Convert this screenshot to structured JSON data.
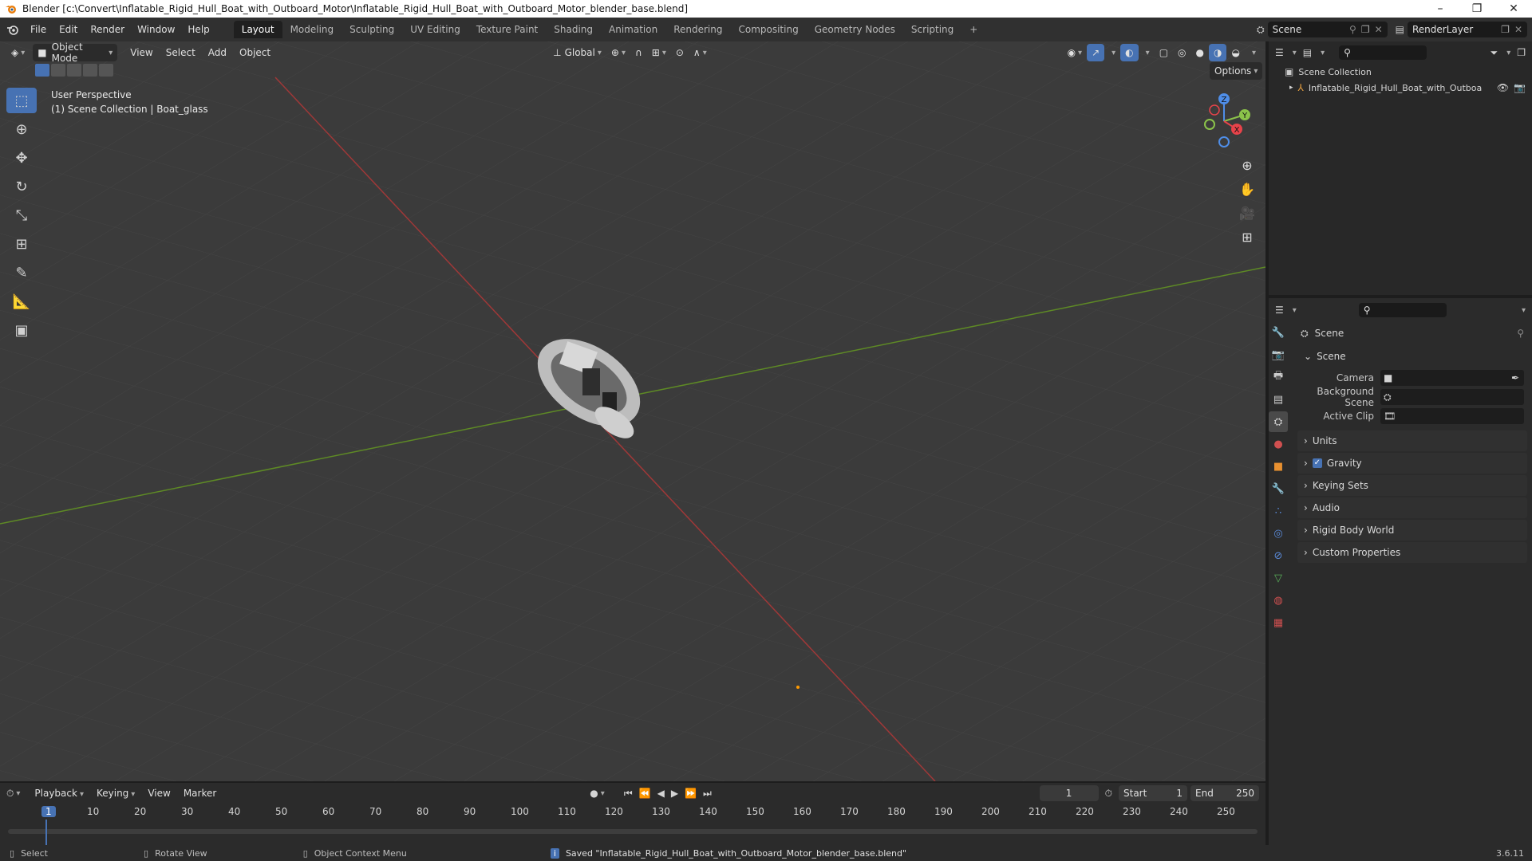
{
  "window": {
    "title": "Blender [c:\\Convert\\Inflatable_Rigid_Hull_Boat_with_Outboard_Motor\\Inflatable_Rigid_Hull_Boat_with_Outboard_Motor_blender_base.blend]",
    "minimize": "–",
    "maximize": "❐",
    "close": "✕"
  },
  "menu": [
    "File",
    "Edit",
    "Render",
    "Window",
    "Help"
  ],
  "workspaces": [
    "Layout",
    "Modeling",
    "Sculpting",
    "UV Editing",
    "Texture Paint",
    "Shading",
    "Animation",
    "Rendering",
    "Compositing",
    "Geometry Nodes",
    "Scripting"
  ],
  "workspace_add": "+",
  "scene_field": "Scene",
  "renderlayer_field": "RenderLayer",
  "viewport": {
    "mode": "Object Mode",
    "menus": [
      "View",
      "Select",
      "Add",
      "Object"
    ],
    "orientation": "Global",
    "options": "Options",
    "overlay_line1": "User Perspective",
    "overlay_line2": "(1) Scene Collection | Boat_glass",
    "gizmo": {
      "z": "Z",
      "y": "Y",
      "x": "X"
    }
  },
  "outliner": {
    "root": "Scene Collection",
    "item": "Inflatable_Rigid_Hull_Boat_with_Outboa"
  },
  "properties": {
    "header": "Scene",
    "section": "Scene",
    "fields": [
      {
        "label": "Camera"
      },
      {
        "label": "Background Scene"
      },
      {
        "label": "Active Clip"
      }
    ],
    "panels": [
      "Units",
      "Gravity",
      "Keying Sets",
      "Audio",
      "Rigid Body World",
      "Custom Properties"
    ],
    "gravity_checked": true
  },
  "timeline": {
    "menus": [
      "Playback",
      "Keying",
      "View",
      "Marker"
    ],
    "current_frame": "1",
    "start_label": "Start",
    "start_value": "1",
    "end_label": "End",
    "end_value": "250",
    "ruler": [
      "1",
      "10",
      "20",
      "30",
      "40",
      "50",
      "60",
      "70",
      "80",
      "90",
      "100",
      "110",
      "120",
      "130",
      "140",
      "150",
      "160",
      "170",
      "180",
      "190",
      "200",
      "210",
      "220",
      "230",
      "240",
      "250"
    ]
  },
  "status": {
    "select": "Select",
    "rotate": "Rotate View",
    "context": "Object Context Menu",
    "message": "Saved \"Inflatable_Rigid_Hull_Boat_with_Outboard_Motor_blender_base.blend\"",
    "version": "3.6.11"
  },
  "colors": {
    "accent": "#4772b3",
    "x_axis": "#c23a3a",
    "y_axis": "#6a9a2a",
    "gizmo_x": "#e8434a",
    "gizmo_y": "#8bc34a",
    "gizmo_z": "#4f8ee8"
  }
}
